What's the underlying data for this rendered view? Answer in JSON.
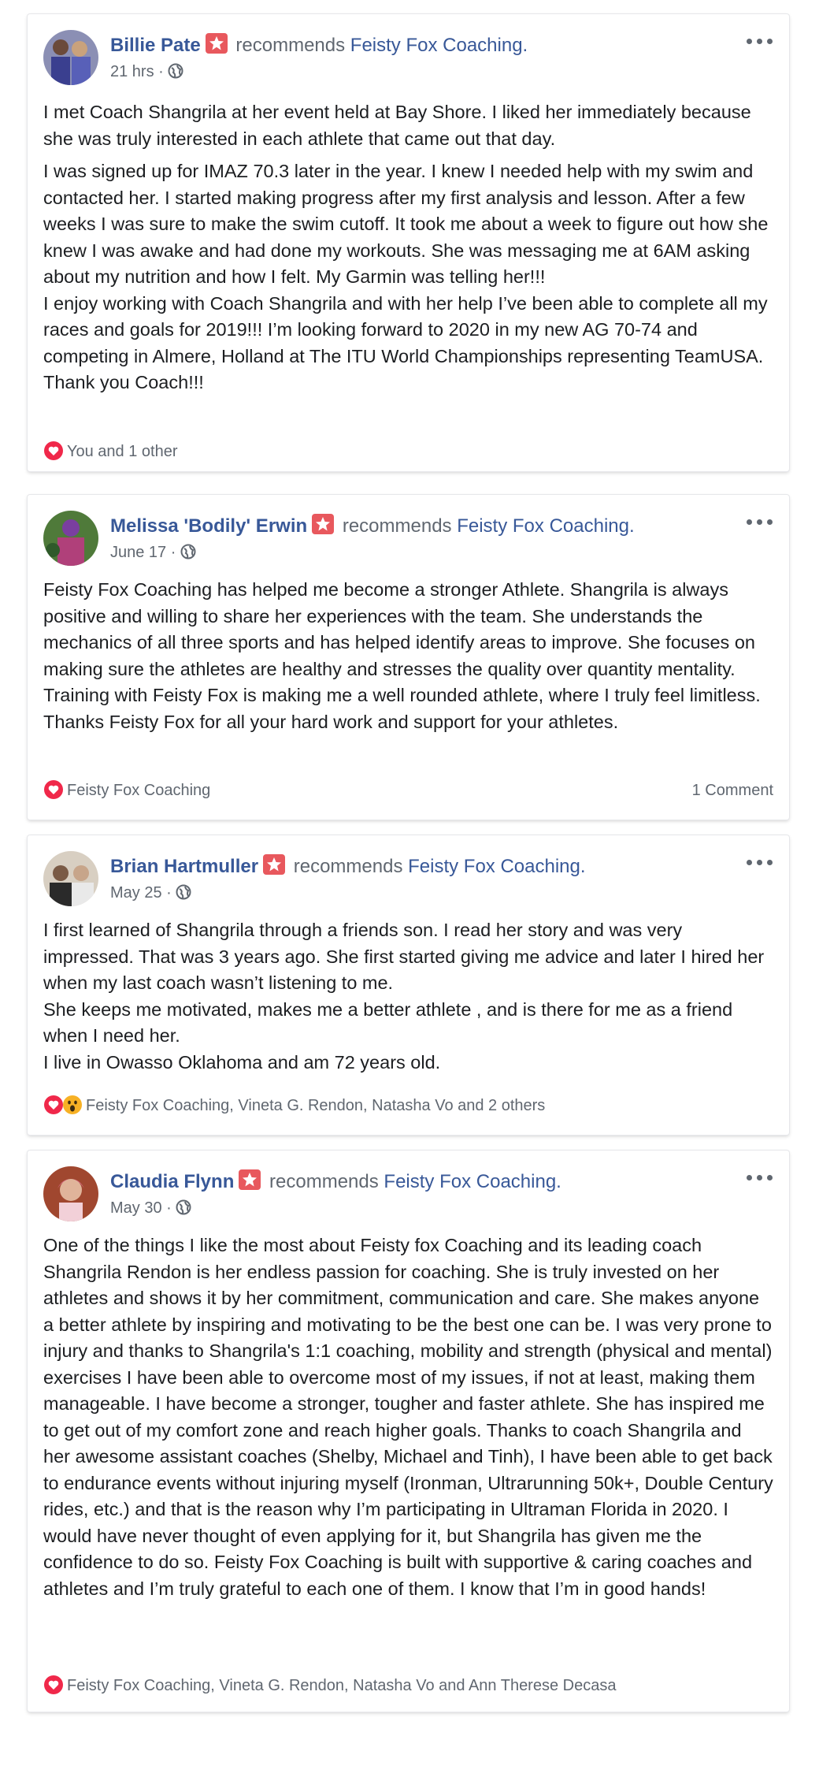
{
  "reviews": [
    {
      "name": "Billie Pate",
      "recommends": "recommends",
      "page": "Feisty Fox Coaching.",
      "time": "21 hrs ·",
      "paragraphs": [
        "I met Coach Shangrila at her event held at Bay Shore. I liked her immediately because she was truly interested in each athlete that came out that day.",
        "I was signed up for IMAZ 70.3 later in the year. I knew I needed help with my swim and contacted her. I started making progress after my first analysis and lesson. After a few weeks I was sure to make the swim cutoff. It took me about a week to figure out how she knew I was awake and had done my workouts. She was messaging me at 6AM asking about my nutrition and how I felt. My Garmin was telling her!!!\nI enjoy working with Coach Shangrila and with her help I’ve been able to complete all my races and goals for 2019!!! I’m looking forward to 2020 in my new AG 70-74 and competing in Almere, Holland at The ITU World Championships representing TeamUSA. Thank you Coach!!!"
      ],
      "reactions": "You and 1 other",
      "comments": ""
    },
    {
      "name": "Melissa 'Bodily' Erwin",
      "recommends": "recommends",
      "page": "Feisty Fox Coaching.",
      "time": "June 17 ·",
      "paragraphs": [
        "Feisty Fox Coaching has helped me become a stronger Athlete. Shangrila is always positive and willing to share her experiences with the team. She understands the mechanics of all three sports and has helped identify areas to improve. She focuses on making sure the athletes are healthy and stresses the quality over quantity mentality. Training with Feisty Fox is making me a well rounded athlete, where I truly feel limitless. Thanks Feisty Fox for all your hard work and support for your athletes."
      ],
      "reactions": "Feisty Fox Coaching",
      "comments": "1 Comment"
    },
    {
      "name": "Brian Hartmuller",
      "recommends": "recommends",
      "page": "Feisty Fox Coaching.",
      "time": "May 25 ·",
      "paragraphs": [
        "I first learned of Shangrila through a friends son. I read her story and was very impressed. That was 3 years ago. She first started giving me advice and later I hired her when my last coach wasn’t listening to me.\nShe keeps me motivated, makes me a better athlete , and is there for me as a friend when I need her.\nI live in Owasso Oklahoma and am 72 years old."
      ],
      "reactions": "Feisty Fox Coaching, Vineta G. Rendon, Natasha Vo and 2 others",
      "comments": ""
    },
    {
      "name": "Claudia Flynn",
      "recommends": "recommends",
      "page": "Feisty Fox Coaching.",
      "time": "May 30 ·",
      "paragraphs": [
        "One of the things I like the most about Feisty fox Coaching and its leading coach Shangrila Rendon is her endless passion for coaching. She is truly invested on her athletes and shows it by her commitment, communication and care. She makes anyone a better athlete by inspiring and motivating to be the best one can be. I was very prone to injury and thanks to Shangrila's 1:1 coaching, mobility and strength (physical and mental) exercises I have been able to overcome most of my issues, if not at least, making them manageable. I have become a stronger, tougher and faster athlete. She has inspired me to get out of my comfort zone and reach higher goals. Thanks to coach Shangrila and her awesome assistant coaches (Shelby, Michael and Tinh), I have been able to get back to endurance events without injuring myself (Ironman, Ultrarunning 50k+, Double Century rides, etc.) and that is the reason why I’m participating in Ultraman Florida in 2020. I would have never thought of even applying for it, but Shangrila has given me the confidence to do so. Feisty Fox Coaching is built with supportive & caring coaches and athletes and I’m truly grateful to each one of them. I know that I’m in good hands!"
      ],
      "reactions": "Feisty Fox Coaching, Vineta G. Rendon, Natasha Vo and Ann Therese Decasa",
      "comments": ""
    }
  ],
  "icons": {
    "badge": "recommendation-star-icon",
    "globe": "globe-icon",
    "more": "more-options-icon",
    "love": "love-reaction-icon",
    "wow": "wow-reaction-icon"
  },
  "colors": {
    "link": "#385898",
    "secondary": "#606770",
    "badge": "#e8585d",
    "love": "#f0284a",
    "wow": "#f7b125"
  }
}
